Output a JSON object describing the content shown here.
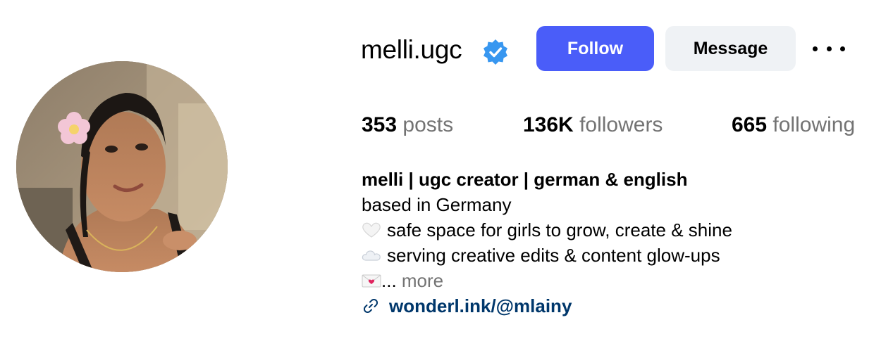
{
  "profile": {
    "username": "melli.ugc",
    "verified_icon": "verified-badge-icon",
    "follow_label": "Follow",
    "message_label": "Message",
    "more_icon": "more-options-icon"
  },
  "stats": {
    "posts_count": "353",
    "posts_label": "posts",
    "followers_count": "136K",
    "followers_label": "followers",
    "following_count": "665",
    "following_label": "following"
  },
  "bio": {
    "name": "melli | ugc creator | german & english",
    "line1": "based in Germany",
    "line2": "safe space for girls to grow, create & shine",
    "line3": "serving creative edits & content glow-ups",
    "line4_truncated": "...",
    "more_label": " more",
    "link_text": "wonderl.ink/@mlainy",
    "line2_icon": "white-heart-icon",
    "line3_icon": "cloud-icon",
    "line4_icon": "love-letter-icon",
    "link_icon": "link-icon"
  },
  "colors": {
    "follow_button": "#4a5df9",
    "message_button": "#eff2f5",
    "link": "#00376b",
    "muted_text": "#737373",
    "verified": "#3897f0"
  }
}
